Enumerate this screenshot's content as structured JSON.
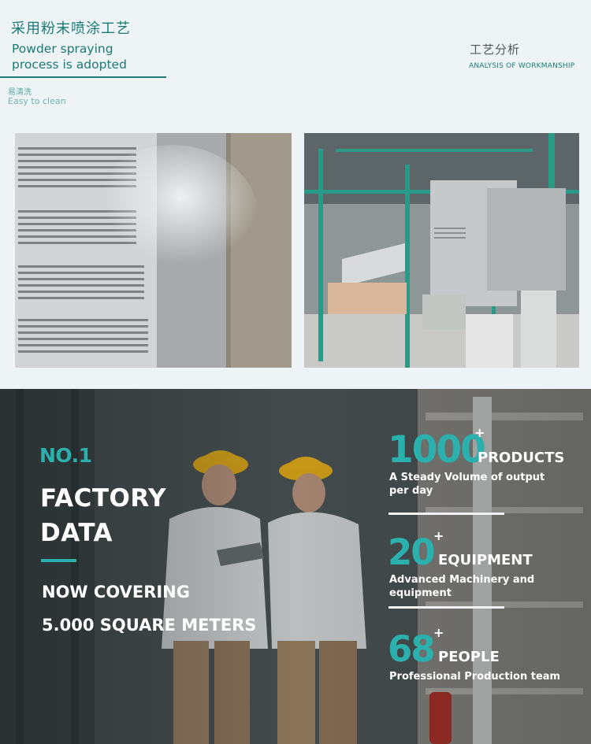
{
  "header": {
    "title_cn": "采用粉末喷涂工艺",
    "title_en": "Powder spraying process is adopted",
    "feature_cn": "易清洗",
    "feature_en": "Easy to clean",
    "analysis_cn": "工艺分析",
    "analysis_en": "ANALYSIS OF WORKMANSHIP"
  },
  "photos": [
    {
      "name": "powder-spray-booth-closeup"
    },
    {
      "name": "powder-spraying-workshop"
    }
  ],
  "factory": {
    "rank": "NO.1",
    "heading_line1": "FACTORY",
    "heading_line2": "DATA",
    "covering": "NOW COVERING",
    "area": "5.000 SQUARE METERS"
  },
  "stats": [
    {
      "number": "1000",
      "plus": "+",
      "label": "PRODUCTS",
      "description": "A Steady Volume of output per day"
    },
    {
      "number": "20",
      "plus": "+",
      "label": "EQUIPMENT",
      "description": "Advanced Machinery and equipment"
    },
    {
      "number": "68",
      "plus": "+",
      "label": "PEOPLE",
      "description": "Professional Production team"
    }
  ],
  "colors": {
    "brand_teal": "#1b7a76",
    "accent_teal": "#2ab0ad",
    "background": "#eef4f5"
  }
}
